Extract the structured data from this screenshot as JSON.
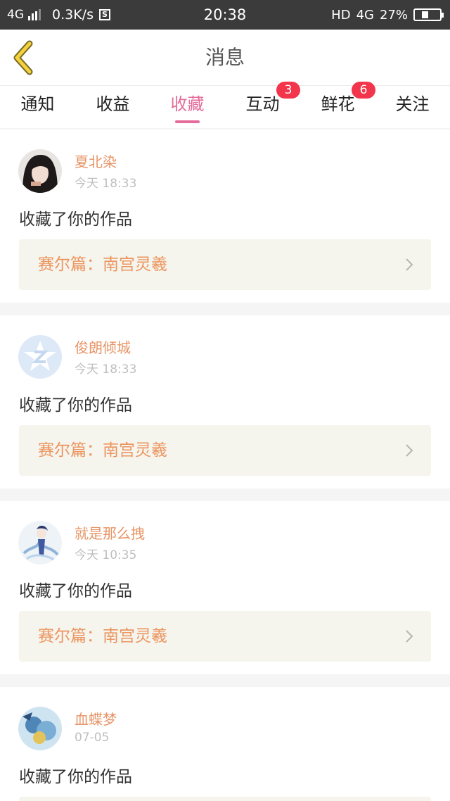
{
  "status_bar": {
    "network": "4G",
    "speed": "0.3K/s",
    "s_icon": "S",
    "time": "20:38",
    "hd": "HD",
    "network2": "4G",
    "battery": "27%",
    "battery_level": 0.27
  },
  "header": {
    "title": "消息"
  },
  "tabs": [
    {
      "label": "通知",
      "badge": ""
    },
    {
      "label": "收益",
      "badge": ""
    },
    {
      "label": "收藏",
      "badge": "",
      "active": true
    },
    {
      "label": "互动",
      "badge": "3"
    },
    {
      "label": "鲜花",
      "badge": "6"
    },
    {
      "label": "关注",
      "badge": ""
    }
  ],
  "colors": {
    "accent": "#e46b9a",
    "name": "#e79465",
    "work": "#ec955f",
    "badge": "#f2354a"
  },
  "messages": [
    {
      "user": "夏北染",
      "time": "今天 18:33",
      "action": "收藏了你的作品",
      "work": "赛尔篇：南宫灵羲"
    },
    {
      "user": "俊朗倾城",
      "time": "今天 18:33",
      "action": "收藏了你的作品",
      "work": "赛尔篇：南宫灵羲"
    },
    {
      "user": "就是那么拽",
      "time": "今天 10:35",
      "action": "收藏了你的作品",
      "work": "赛尔篇：南宫灵羲"
    },
    {
      "user": "血蝶梦",
      "time": "07-05",
      "action": "收藏了你的作品",
      "work": ""
    }
  ]
}
